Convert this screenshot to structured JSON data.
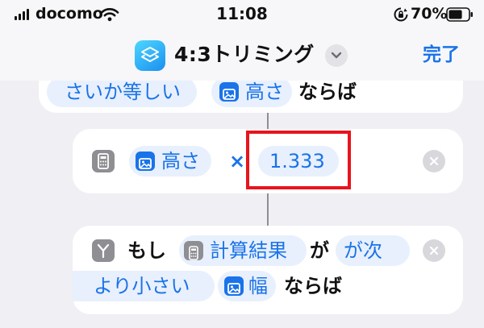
{
  "status_bar": {
    "carrier": "docomo",
    "time": "11:08",
    "battery": "70%",
    "battery_level": 0.7
  },
  "nav": {
    "title": "4:3トリミング",
    "done_label": "完了"
  },
  "card_top": {
    "token_cond": "さいか等しい",
    "token_var": "高さ",
    "suffix": "ならば"
  },
  "card_calc": {
    "token_var": "高さ",
    "operator": "×",
    "token_value": "1.333"
  },
  "card_if": {
    "prefix": "もし",
    "token_result": "計算結果",
    "ga": "が",
    "token_cond_1": "が次",
    "token_cond_2": "より小さい",
    "token_var": "幅",
    "suffix": "ならば"
  },
  "colors": {
    "accent": "#1a73e8",
    "highlight": "#e8141c",
    "background": "#efeff4"
  },
  "icons": [
    "signal-icon",
    "wifi-icon",
    "rotation-lock-icon",
    "battery-icon",
    "shortcuts-app-icon",
    "chevron-down-icon",
    "calculator-icon",
    "photo-variable-icon",
    "if-branch-icon",
    "remove-icon"
  ]
}
